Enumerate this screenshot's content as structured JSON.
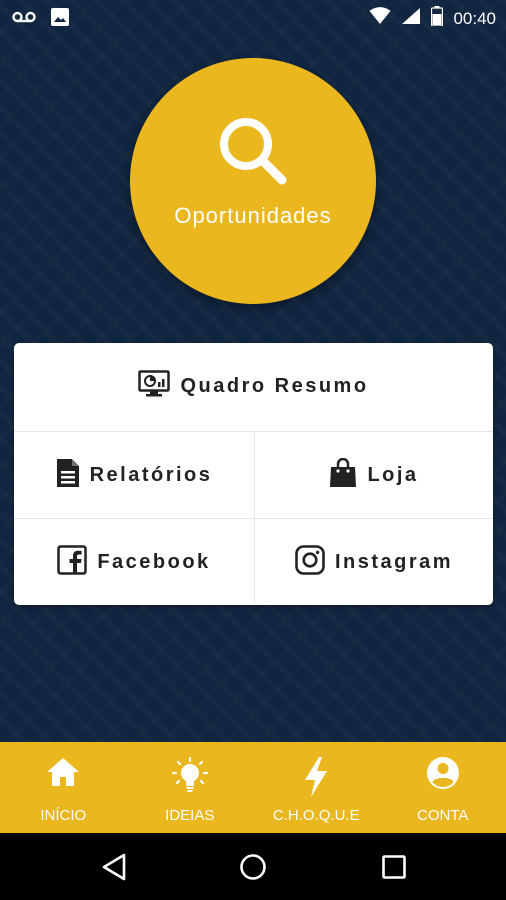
{
  "status_bar": {
    "time": "00:40",
    "icons": [
      "voicemail-icon",
      "image-icon",
      "wifi-icon",
      "signal-icon",
      "battery-icon"
    ]
  },
  "hero": {
    "label": "Oportunidades",
    "icon": "search-icon"
  },
  "menu": {
    "quadro_resumo": {
      "label": "Quadro Resumo",
      "icon": "monitor-chart-icon"
    },
    "relatorios": {
      "label": "Relatórios",
      "icon": "document-icon"
    },
    "loja": {
      "label": "Loja",
      "icon": "shopping-bag-icon"
    },
    "facebook": {
      "label": "Facebook",
      "icon": "facebook-icon"
    },
    "instagram": {
      "label": "Instagram",
      "icon": "instagram-icon"
    }
  },
  "bottom_nav": [
    {
      "label": "INÍCIO",
      "icon": "home-icon"
    },
    {
      "label": "IDEIAS",
      "icon": "lightbulb-icon"
    },
    {
      "label": "C.H.O.Q.U.E",
      "icon": "lightning-icon"
    },
    {
      "label": "CONTA",
      "icon": "account-icon"
    }
  ],
  "system_nav": [
    "back-icon",
    "home-circle-icon",
    "recents-icon"
  ],
  "colors": {
    "accent": "#eab71e",
    "background": "#10253f",
    "card": "#ffffff",
    "text_dark": "#222222"
  }
}
